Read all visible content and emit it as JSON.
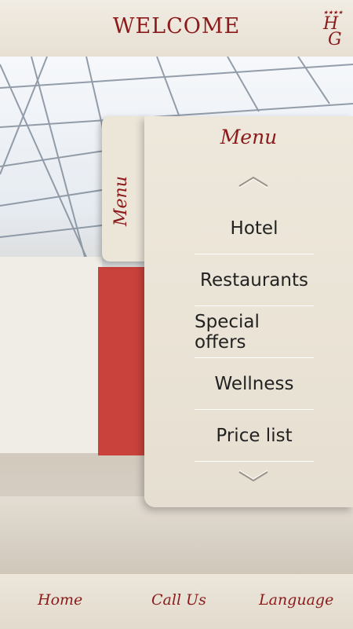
{
  "header": {
    "title": "WELCOME",
    "logo_stars": "★★★★",
    "logo_letter1": "H",
    "logo_letter2": "G"
  },
  "menu": {
    "tab_label": "Menu",
    "title": "Menu",
    "items": [
      "Hotel",
      "Restaurants",
      "Special offers",
      "Wellness",
      "Price list"
    ]
  },
  "bottom_nav": {
    "home": "Home",
    "call": "Call Us",
    "language": "Language"
  },
  "colors": {
    "accent": "#8b1a1a",
    "panel": "#ece6d9"
  },
  "icons": {
    "scroll_up": "chevron-up-icon",
    "scroll_down": "chevron-down-icon"
  }
}
